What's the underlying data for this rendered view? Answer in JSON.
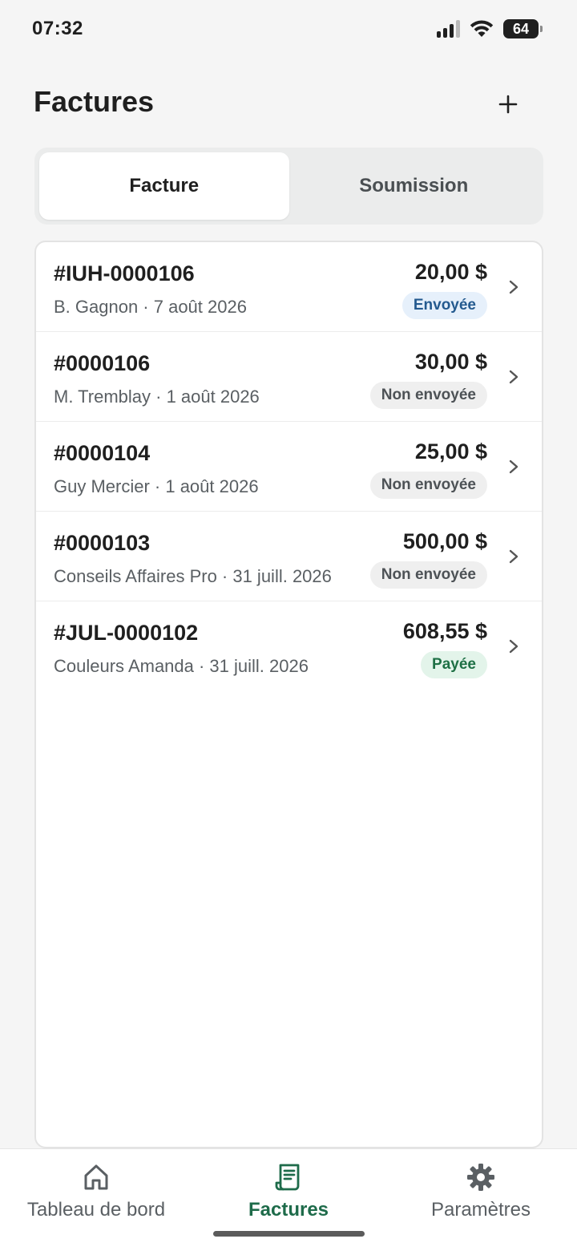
{
  "status_bar": {
    "time": "07:32",
    "battery": "64"
  },
  "header": {
    "title": "Factures",
    "add_icon": "plus-icon"
  },
  "segments": [
    {
      "label": "Facture",
      "active": true
    },
    {
      "label": "Soumission",
      "active": false
    }
  ],
  "invoices": [
    {
      "number": "#IUH-0000106",
      "meta": "B. Gagnon · 7 août 2026",
      "amount": "20,00 $",
      "status": "Envoyée",
      "status_kind": "sent"
    },
    {
      "number": "#0000106",
      "meta": "M. Tremblay · 1 août 2026",
      "amount": "30,00 $",
      "status": "Non envoyée",
      "status_kind": "unsent"
    },
    {
      "number": "#0000104",
      "meta": "Guy Mercier · 1 août 2026",
      "amount": "25,00 $",
      "status": "Non envoyée",
      "status_kind": "unsent"
    },
    {
      "number": "#0000103",
      "meta": "Conseils Affaires Pro · 31 juill. 2026",
      "amount": "500,00 $",
      "status": "Non envoyée",
      "status_kind": "unsent"
    },
    {
      "number": "#JUL-0000102",
      "meta": "Couleurs Amanda · 31 juill. 2026",
      "amount": "608,55 $",
      "status": "Payée",
      "status_kind": "paid"
    }
  ],
  "bottom_nav": [
    {
      "label": "Tableau de bord",
      "icon": "home-icon",
      "active": false
    },
    {
      "label": "Factures",
      "icon": "receipt-icon",
      "active": true
    },
    {
      "label": "Paramètres",
      "icon": "gear-icon",
      "active": false
    }
  ],
  "colors": {
    "accent": "#1e6b4a",
    "sent_badge": "#e6f0fb",
    "unsent_badge": "#efefef",
    "paid_badge": "#e3f4ea"
  }
}
